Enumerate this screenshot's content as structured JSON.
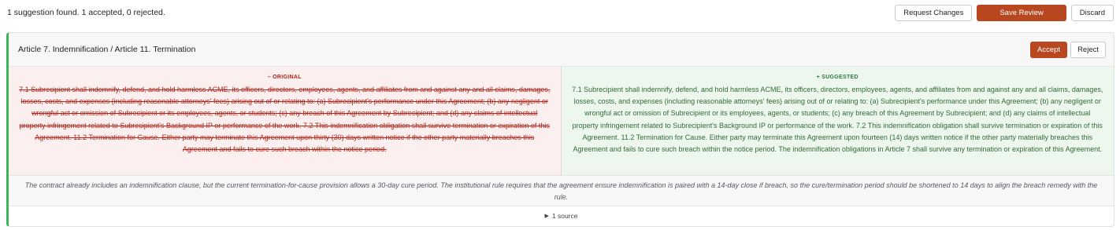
{
  "topbar": {
    "summary": "1 suggestion found. 1 accepted, 0 rejected.",
    "request_changes_label": "Request Changes",
    "save_review_label": "Save Review",
    "discard_label": "Discard"
  },
  "suggestion": {
    "title": "Article 7. Indemnification / Article 11. Termination",
    "accept_label": "Accept",
    "reject_label": "Reject",
    "original_label": "– ORIGINAL",
    "original_text": "7.1 Subrecipient shall indemnify, defend, and hold harmless ACME, its officers, directors, employees, agents, and affiliates from and against any and all claims, damages, losses, costs, and expenses (including reasonable attorneys' fees) arising out of or relating to: (a) Subrecipient's performance under this Agreement; (b) any negligent or wrongful act or omission of Subrecipient or its employees, agents, or students; (c) any breach of this Agreement by Subrecipient; and (d) any claims of intellectual property infringement related to Subrecipient's Background IP or performance of the work. 7.2 This indemnification obligation shall survive termination or expiration of this Agreement. 11.2 Termination for Cause. Either party may terminate this Agreement upon thirty (30) days written notice if the other party materially breaches this Agreement and fails to cure such breach within the notice period.",
    "suggested_label": "+ SUGGESTED",
    "suggested_text": "7.1 Subrecipient shall indemnify, defend, and hold harmless ACME, its officers, directors, employees, agents, and affiliates from and against any and all claims, damages, losses, costs, and expenses (including reasonable attorneys' fees) arising out of or relating to: (a) Subrecipient's performance under this Agreement; (b) any negligent or wrongful act or omission of Subrecipient or its employees, agents, or students; (c) any breach of this Agreement by Subrecipient; and (d) any claims of intellectual property infringement related to Subrecipient's Background IP or performance of the work. 7.2 This indemnification obligation shall survive termination or expiration of this Agreement. 11.2 Termination for Cause. Either party may terminate this Agreement upon fourteen (14) days written notice if the other party materially breaches this Agreement and fails to cure such breach within the notice period. The indemnification obligations in Article 7 shall survive any termination or expiration of this Agreement.",
    "rationale": "The contract already includes an indemnification clause, but the current termination-for-cause provision allows a 30-day cure period. The institutional rule requires that the agreement ensure indemnification is paired with a 14-day close if breach, so the cure/termination period should be shortened to 14 days to align the breach remedy with the rule.",
    "sources_label": "1 source",
    "sources_icon": "triangle-right-icon"
  },
  "colors": {
    "accent": "#b8461f",
    "border_accent": "#3cb55a",
    "removed_text": "#b42318",
    "added_text": "#2f6b35"
  }
}
